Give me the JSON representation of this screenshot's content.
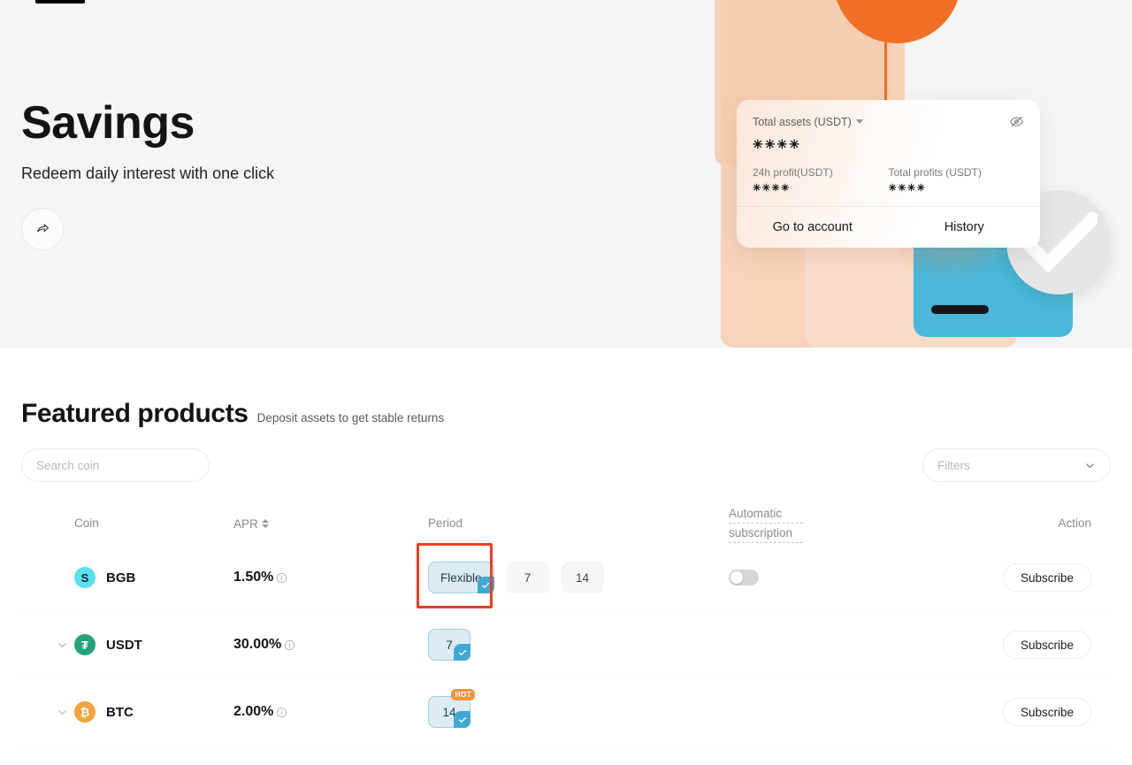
{
  "hero": {
    "title": "Savings",
    "subtitle": "Redeem daily interest with one click",
    "share_icon": "share-icon",
    "card": {
      "total_assets_label": "Total assets (USDT)",
      "total_assets_value": "✳✳✳✳",
      "eye_icon": "eye-off-icon",
      "profit_24h_label": "24h profit(USDT)",
      "profit_24h_value": "✳✳✳✳",
      "total_profits_label": "Total profits (USDT)",
      "total_profits_value": "✳✳✳✳",
      "go_to_account": "Go to account",
      "history": "History"
    }
  },
  "featured": {
    "title": "Featured products",
    "subtitle": "Deposit assets to get stable returns",
    "search_placeholder": "Search coin",
    "search_value": "",
    "search_icon": "search-icon",
    "filters_label": "Filters",
    "filters_chevron": "chevron-down-icon"
  },
  "table": {
    "headers": {
      "coin": "Coin",
      "apr": "APR",
      "period": "Period",
      "automatic_line1": "Automatic",
      "automatic_line2": "subscription",
      "action": "Action"
    },
    "rows": [
      {
        "coin": "BGB",
        "coin_symbol": "S",
        "coin_color": "#5ae0f0",
        "coin_text_color": "#0a2b33",
        "apr": "1.50%",
        "info_icon": "info-icon",
        "expandable": false,
        "periods": [
          {
            "label": "Flexible",
            "selected": true,
            "hot": false,
            "highlighted": true
          },
          {
            "label": "7",
            "selected": false,
            "hot": false,
            "highlighted": false
          },
          {
            "label": "14",
            "selected": false,
            "hot": false,
            "highlighted": false
          }
        ],
        "auto_subscription": false,
        "show_toggle": true,
        "action_label": "Subscribe"
      },
      {
        "coin": "USDT",
        "coin_symbol": "₮",
        "coin_color": "#26a17b",
        "coin_text_color": "#ffffff",
        "apr": "30.00%",
        "info_icon": "info-icon",
        "expandable": true,
        "periods": [
          {
            "label": "7",
            "selected": true,
            "hot": false,
            "highlighted": false
          }
        ],
        "auto_subscription": null,
        "show_toggle": false,
        "action_label": "Subscribe"
      },
      {
        "coin": "BTC",
        "coin_symbol": "₿",
        "coin_color": "#f2a33c",
        "coin_text_color": "#ffffff",
        "apr": "2.00%",
        "info_icon": "info-icon",
        "expandable": true,
        "periods": [
          {
            "label": "14",
            "selected": true,
            "hot": true,
            "hot_label": "HOT",
            "highlighted": false
          }
        ],
        "auto_subscription": null,
        "show_toggle": false,
        "action_label": "Subscribe"
      }
    ]
  },
  "colors": {
    "accent_orange": "#ef7025",
    "accent_blue": "#3fa9d4",
    "highlight_red": "#f03c20",
    "hero_bg": "#f5f5f5"
  }
}
